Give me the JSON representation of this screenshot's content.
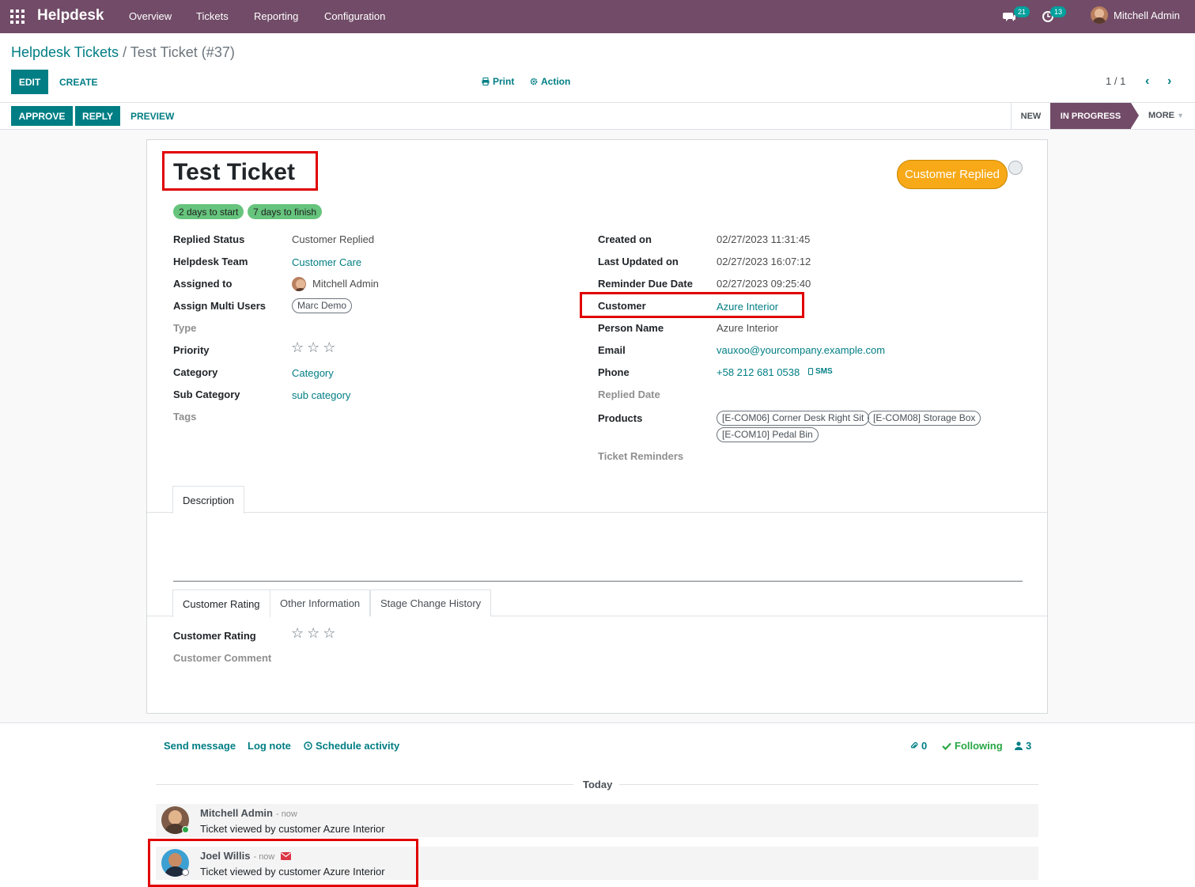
{
  "navbar": {
    "brand": "Helpdesk",
    "menu": [
      "Overview",
      "Tickets",
      "Reporting",
      "Configuration"
    ],
    "messages_count": "21",
    "activities_count": "13",
    "user": "Mitchell Admin"
  },
  "breadcrumb": {
    "parent": "Helpdesk Tickets",
    "separator": "/",
    "current": "Test Ticket (#37)"
  },
  "toolbar": {
    "edit": "EDIT",
    "create": "CREATE",
    "print": "Print",
    "action": "Action",
    "pager": "1 / 1"
  },
  "statusbar": {
    "buttons": [
      "APPROVE",
      "REPLY",
      "PREVIEW"
    ],
    "stages": [
      "NEW",
      "IN PROGRESS"
    ],
    "more": "MORE"
  },
  "form": {
    "title": "Test Ticket",
    "pills": [
      "2 days to start",
      "7 days to finish"
    ],
    "ribbon": "Customer Replied",
    "left_fields": [
      {
        "label": "Replied Status",
        "value": "Customer Replied"
      },
      {
        "label": "Helpdesk Team",
        "value": "Customer Care"
      },
      {
        "label": "Assigned to",
        "value": "Mitchell Admin"
      },
      {
        "label": "Assign Multi Users",
        "value": "Marc Demo"
      },
      {
        "label": "Type",
        "value": ""
      },
      {
        "label": "Priority",
        "value": ""
      },
      {
        "label": "Category",
        "value": "Category"
      },
      {
        "label": "Sub Category",
        "value": "sub category"
      },
      {
        "label": "Tags",
        "value": ""
      }
    ],
    "right_fields": [
      {
        "label": "Created on",
        "value": "02/27/2023 11:31:45"
      },
      {
        "label": "Last Updated on",
        "value": "02/27/2023 16:07:12"
      },
      {
        "label": "Reminder Due Date",
        "value": "02/27/2023 09:25:40"
      },
      {
        "label": "Customer",
        "value": "Azure Interior"
      },
      {
        "label": "Person Name",
        "value": "Azure Interior"
      },
      {
        "label": "Email",
        "value": "vauxoo@yourcompany.example.com"
      },
      {
        "label": "Phone",
        "value": "+58 212 681 0538"
      },
      {
        "label": "Replied Date",
        "value": ""
      },
      {
        "label": "Products",
        "value": ""
      },
      {
        "label": "Ticket Reminders",
        "value": ""
      }
    ],
    "sms": "SMS",
    "products": [
      "[E-COM06] Corner Desk Right Sit",
      "[E-COM08] Storage Box",
      "[E-COM10] Pedal Bin"
    ],
    "priority_stars": 0,
    "tab_top": [
      "Description"
    ],
    "tabs_bottom": [
      "Customer Rating",
      "Other Information",
      "Stage Change History"
    ],
    "rating_label": "Customer Rating",
    "rating_stars": 0,
    "comment_label": "Customer Comment"
  },
  "chatter": {
    "send_message": "Send message",
    "log_note": "Log note",
    "schedule_activity": "Schedule activity",
    "attachments": "0",
    "following": "Following",
    "followers": "3",
    "today": "Today",
    "messages": [
      {
        "author": "Mitchell Admin",
        "date": "- now",
        "body": "Ticket viewed by customer Azure Interior"
      },
      {
        "author": "Joel Willis",
        "date": "- now",
        "body": "Ticket viewed by customer Azure Interior"
      }
    ]
  },
  "colors": {
    "brand": "#714b67",
    "primary": "#017e84",
    "ribbon": "#f7a918",
    "pill": "#66c47d",
    "highlight": "#e00000"
  }
}
